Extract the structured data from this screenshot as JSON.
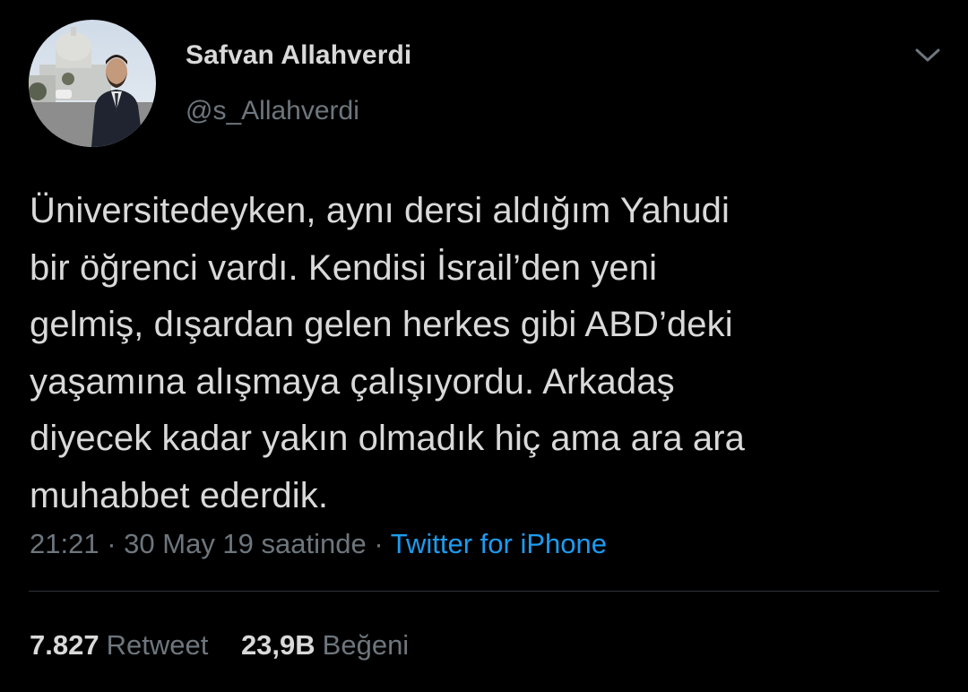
{
  "tweet": {
    "author": {
      "display_name": "Safvan Allahverdi",
      "handle": "@s_Allahverdi"
    },
    "text_lines": [
      "Üniversitedeyken, aynı dersi aldığım Yahudi",
      "bir öğrenci vardı. Kendisi İsrail’den yeni",
      "gelmiş, dışardan gelen herkes gibi ABD’deki",
      "yaşamına alışmaya çalışıyordu. Arkadaş",
      "diyecek kadar yakın olmadık hiç ama ara ara",
      "muhabbet ederdik."
    ],
    "time": "21:21",
    "separator": "·",
    "date": "30 May 19 saatinde",
    "source": "Twitter for iPhone",
    "stats": {
      "retweets_count": "7.827",
      "retweets_label": "Retweet",
      "likes_count": "23,9B",
      "likes_label": "Beğeni"
    }
  },
  "icons": {
    "more_menu": "chevron-down-icon"
  },
  "colors": {
    "background": "#000000",
    "primary_text": "#d9d9d9",
    "secondary_text": "#6e767d",
    "link": "#1d9bf0",
    "divider": "#2f3336"
  }
}
